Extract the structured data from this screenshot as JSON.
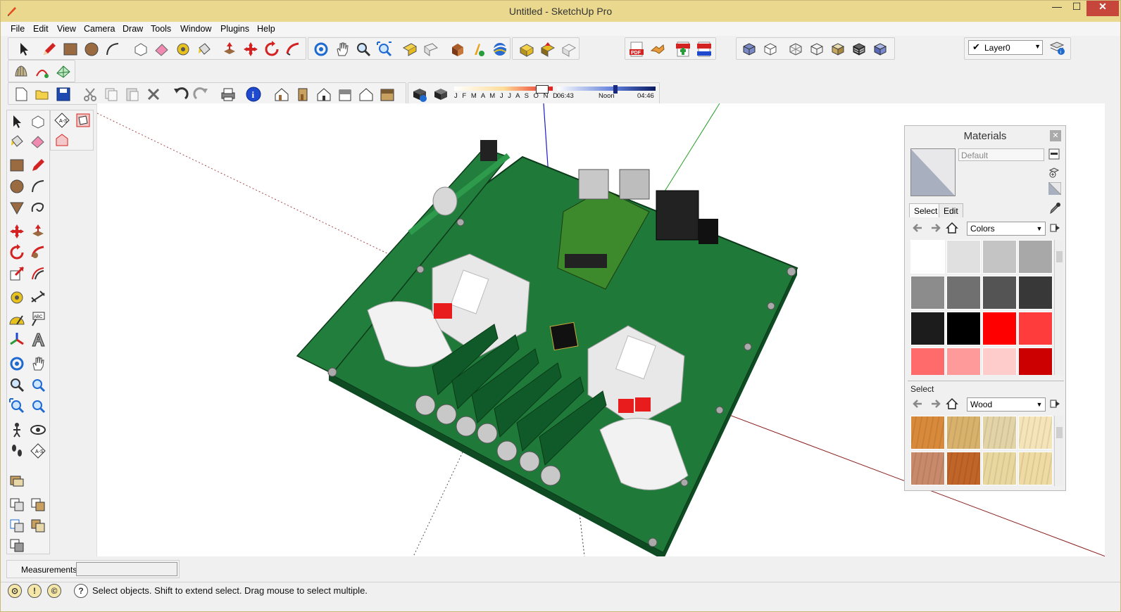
{
  "window": {
    "title": "Untitled - SketchUp Pro",
    "minimize": "—",
    "maximize": "☐",
    "close": "✕"
  },
  "menu": [
    {
      "label": "File"
    },
    {
      "label": "Edit"
    },
    {
      "label": "View"
    },
    {
      "label": "Camera"
    },
    {
      "label": "Draw"
    },
    {
      "label": "Tools"
    },
    {
      "label": "Window"
    },
    {
      "label": "Plugins"
    },
    {
      "label": "Help"
    }
  ],
  "layer": {
    "check": "✔",
    "value": "Layer0",
    "arrow": "▼"
  },
  "timeline": {
    "months": "J F M A M J J A S O N D",
    "start_time": "06:43",
    "noon": "Noon",
    "end_time": "04:46"
  },
  "materials": {
    "title": "Materials",
    "close": "✕",
    "current_name": "Default",
    "tab_select": "Select",
    "tab_edit": "Edit",
    "library_top": "Colors",
    "section_bottom": "Select",
    "library_bottom": "Wood",
    "dropdown_arrow": "▼",
    "colors": [
      "#ffffff",
      "#e0e0e0",
      "#c4c4c4",
      "#a8a8a8",
      "#8c8c8c",
      "#707070",
      "#545454",
      "#383838",
      "#1c1c1c",
      "#000000",
      "#ff0000",
      "#ff3c3c",
      "#ff6a6a",
      "#ff9a9a",
      "#ffcccc",
      "#cc0000"
    ],
    "woods": [
      "#d88a3a",
      "#d8b26c",
      "#e2d4a6",
      "#f4e4b8",
      "#c88a6a",
      "#c06428",
      "#e8d8a0",
      "#eedaa2"
    ]
  },
  "measurements": {
    "label": "Measurements",
    "value": ""
  },
  "status": {
    "text": "Select objects. Shift to extend select. Drag mouse to select multiple."
  }
}
